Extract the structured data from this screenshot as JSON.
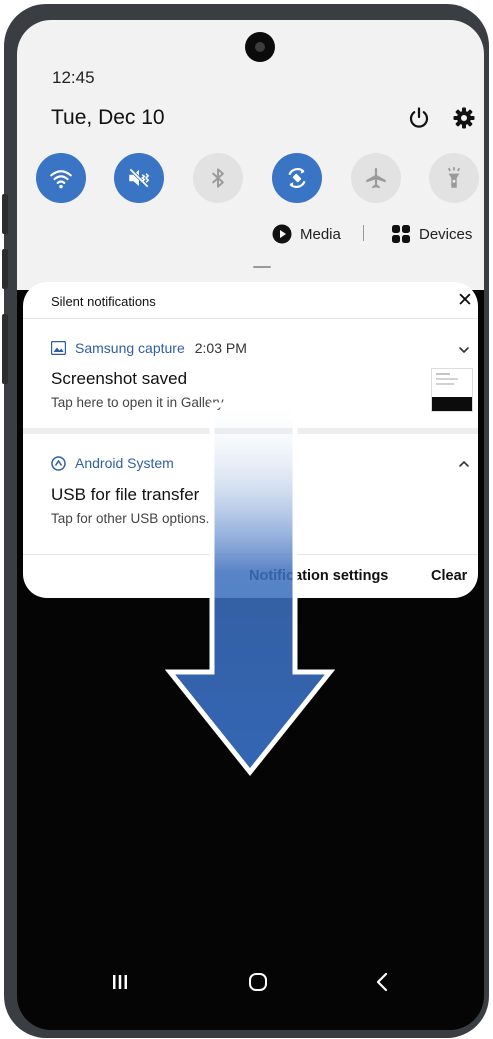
{
  "status": {
    "time": "12:45",
    "date": "Tue, Dec 10"
  },
  "header_icons": [
    "power-icon",
    "gear-icon"
  ],
  "quick_settings": [
    {
      "name": "wifi",
      "icon": "wifi-icon",
      "active": true
    },
    {
      "name": "sound",
      "icon": "mute-icon",
      "active": true
    },
    {
      "name": "bluetooth",
      "icon": "bluetooth-icon",
      "active": false
    },
    {
      "name": "auto-rotate",
      "icon": "auto-rotate-icon",
      "active": true
    },
    {
      "name": "airplane-mode",
      "icon": "airplane-icon",
      "active": false
    },
    {
      "name": "flashlight",
      "icon": "flashlight-icon",
      "active": false
    }
  ],
  "media": {
    "media_label": "Media",
    "devices_label": "Devices"
  },
  "notifications": {
    "section_title": "Silent notifications",
    "items": [
      {
        "app": "Samsung capture",
        "time": "2:03 PM",
        "title": "Screenshot saved",
        "text": "Tap here to open it in Gallery."
      },
      {
        "app": "Android System",
        "title": "USB for file transfer",
        "text": "Tap for other USB options."
      }
    ],
    "settings_label": "Notification settings",
    "clear_label": "Clear"
  },
  "colors": {
    "accent": "#3a74c4",
    "inactive": "#e2e2e2",
    "app_name": "#2f5fa8"
  }
}
